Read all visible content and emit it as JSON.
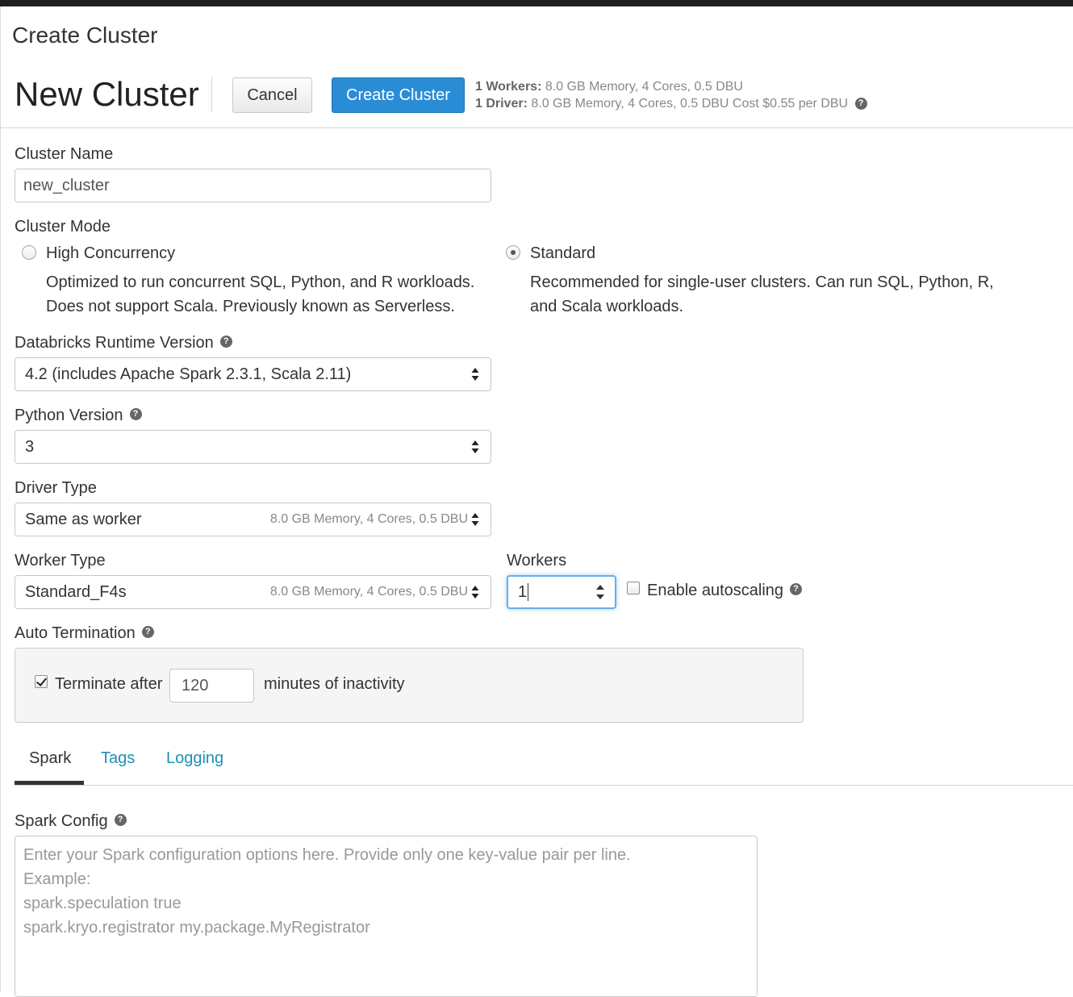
{
  "window": {
    "title": "Create Cluster"
  },
  "header": {
    "heading": "New Cluster",
    "cancel_label": "Cancel",
    "create_label": "Create Cluster",
    "summary_workers_label": "1 Workers:",
    "summary_workers_value": " 8.0 GB Memory, 4 Cores, 0.5 DBU",
    "summary_driver_label": "1 Driver:",
    "summary_driver_value": " 8.0 GB Memory, 4 Cores, 0.5 DBU Cost $0.55 per DBU"
  },
  "cluster_name": {
    "label": "Cluster Name",
    "value": "new_cluster"
  },
  "cluster_mode": {
    "label": "Cluster Mode",
    "options": [
      {
        "label": "High Concurrency",
        "selected": false,
        "desc1": "Optimized to run concurrent SQL, Python, and R workloads.",
        "desc2": "Does not support Scala. Previously known as Serverless."
      },
      {
        "label": "Standard",
        "selected": true,
        "desc1": "Recommended for single-user clusters. Can run SQL, Python, R,",
        "desc2": "and Scala workloads."
      }
    ]
  },
  "runtime": {
    "label": "Databricks Runtime Version",
    "value": "4.2 (includes Apache Spark 2.3.1, Scala 2.11)"
  },
  "python": {
    "label": "Python Version",
    "value": "3"
  },
  "driver_type": {
    "label": "Driver Type",
    "value": "Same as worker",
    "meta": "8.0 GB Memory, 4 Cores, 0.5 DBU"
  },
  "worker_type": {
    "label": "Worker Type",
    "value": "Standard_F4s",
    "meta": "8.0 GB Memory, 4 Cores, 0.5 DBU"
  },
  "workers": {
    "label": "Workers",
    "value": "1",
    "autoscaling_label": "Enable autoscaling",
    "autoscaling_checked": false
  },
  "auto_termination": {
    "label": "Auto Termination",
    "checkbox_label": "Terminate after",
    "checked": true,
    "minutes": "120",
    "suffix": "minutes of inactivity"
  },
  "tabs": [
    {
      "label": "Spark",
      "active": true
    },
    {
      "label": "Tags",
      "active": false
    },
    {
      "label": "Logging",
      "active": false
    }
  ],
  "spark_config": {
    "label": "Spark Config",
    "placeholder": "Enter your Spark configuration options here. Provide only one key-value pair per line.\nExample:\nspark.speculation true\nspark.kryo.registrator my.package.MyRegistrator"
  },
  "icons": {
    "help": "question-circle-icon",
    "select": "sort-arrows-icon",
    "spinner": "spinner-arrows-icon"
  },
  "colors": {
    "primary": "#2b8cd6",
    "link": "#1f8fb5",
    "focus": "#66afe9"
  }
}
